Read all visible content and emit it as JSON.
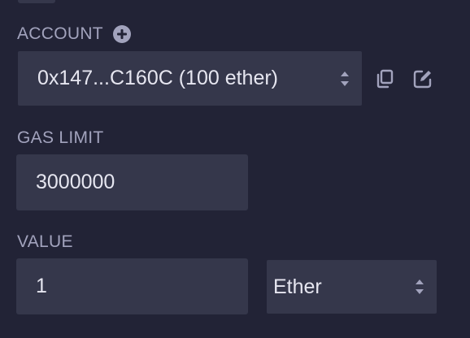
{
  "account": {
    "label": "ACCOUNT",
    "add_icon": "plus-circle-icon",
    "selected": "0x147...C160C (100 ether)",
    "copy_icon": "copy-icon",
    "edit_icon": "edit-icon"
  },
  "gas_limit": {
    "label": "GAS LIMIT",
    "value": "3000000"
  },
  "value": {
    "label": "VALUE",
    "amount": "1",
    "unit": "Ether"
  },
  "colors": {
    "background": "#222336",
    "field": "#35374b",
    "label": "#a2a3bd",
    "text": "#e6e6f0"
  }
}
